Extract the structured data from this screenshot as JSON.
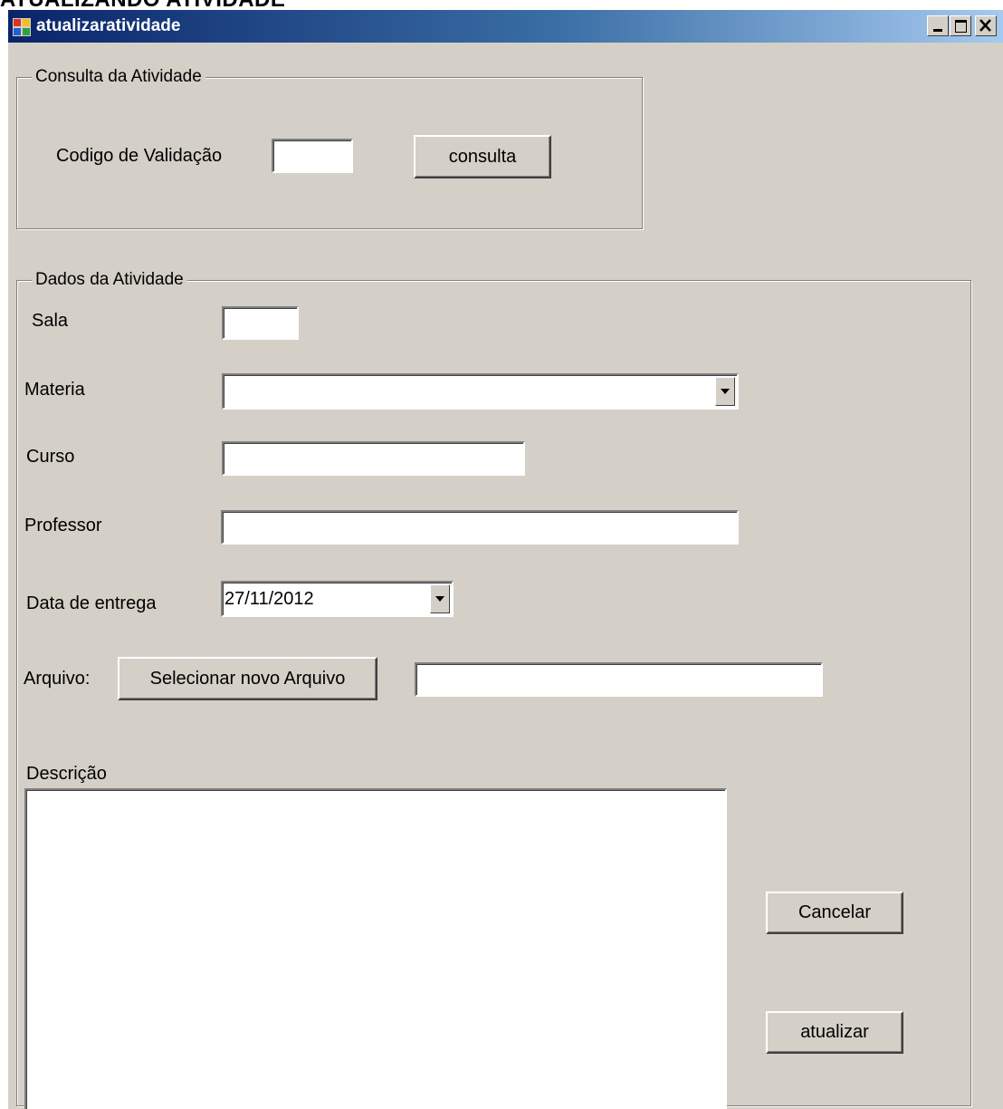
{
  "document": {
    "heading": "ATUALIZANDO ATIVIDADE"
  },
  "window": {
    "title": "atualizaratividade",
    "controls": {
      "minimize": "_",
      "maximize": "□",
      "close": "×"
    }
  },
  "consulta": {
    "group_title": "Consulta da Atividade",
    "codigo_label": "Codigo de Validação",
    "codigo_value": "",
    "consulta_button": "consulta"
  },
  "dados": {
    "group_title": "Dados da Atividade",
    "sala_label": "Sala",
    "sala_value": "",
    "materia_label": "Materia",
    "materia_value": "",
    "curso_label": "Curso",
    "curso_value": "",
    "professor_label": "Professor",
    "professor_value": "",
    "data_label": "Data de entrega",
    "data_value": "27/11/2012",
    "arquivo_label": "Arquivo:",
    "arquivo_button": "Selecionar novo Arquivo",
    "arquivo_value": "",
    "descricao_label": "Descrição",
    "descricao_value": "",
    "cancelar_button": "Cancelar",
    "atualizar_button": "atualizar"
  }
}
